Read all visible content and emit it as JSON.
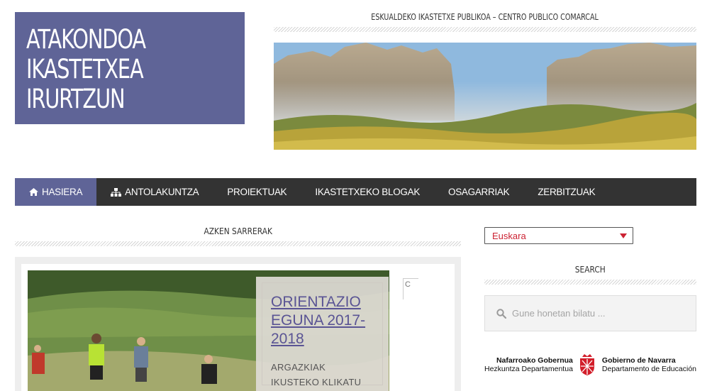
{
  "site": {
    "logo_lines": [
      "ATAKONDOA",
      "IKASTETXEA",
      "IRURTZUN"
    ],
    "tagline": "ESKUALDEKO IKASTETXE PUBLIKOA – CENTRO PUBLICO COMARCAL"
  },
  "nav": {
    "items": [
      {
        "label": "HASIERA",
        "icon": "home-icon",
        "active": true
      },
      {
        "label": "ANTOLAKUNTZA",
        "icon": "sitemap-icon",
        "active": false
      },
      {
        "label": "PROIEKTUAK",
        "active": false
      },
      {
        "label": "IKASTETXEKO BLOGAK",
        "active": false
      },
      {
        "label": "OSAGARRIAK",
        "active": false
      },
      {
        "label": "ZERBITZUAK",
        "active": false
      }
    ]
  },
  "main": {
    "section_title": "AZKEN SARRERAK",
    "post": {
      "title": "ORIENTAZIO EGUNA 2017-2018",
      "excerpt": "ARGAZKIAK IKUSTEKO KLIKATU"
    },
    "broken_image_alt": "C"
  },
  "sidebar": {
    "language_select": {
      "value": "Euskara"
    },
    "search_title": "SEARCH",
    "search_placeholder": "Gune honetan bilatu ...",
    "gov_logo": {
      "left_line1": "Nafarroako Gobernua",
      "left_line2": "Hezkuntza Departamentua",
      "right_line1": "Gobierno de Navarra",
      "right_line2": "Departamento de Educación"
    }
  },
  "colors": {
    "accent": "#5f6497",
    "nav_bg": "#333333",
    "lang_text": "#cc2233",
    "post_title": "#5a5494"
  }
}
